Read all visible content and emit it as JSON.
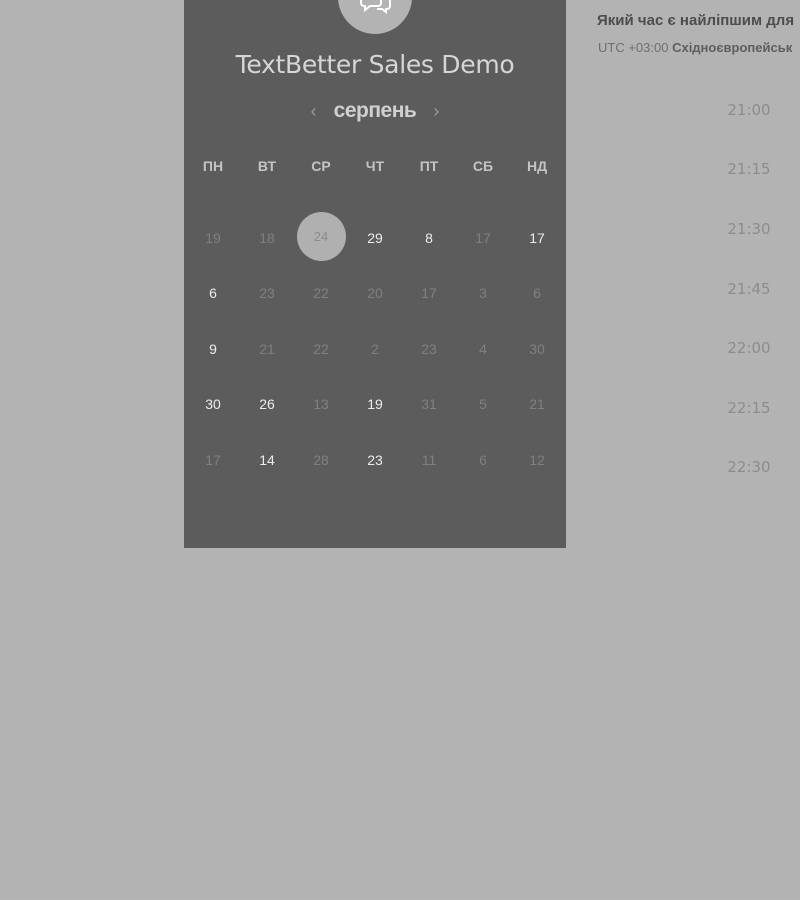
{
  "event": {
    "title": "TextBetter Sales Demo",
    "logo_icon": "chat-bubbles-icon"
  },
  "calendar": {
    "month": "серпень",
    "prev_icon": "chevron-left-icon",
    "next_icon": "chevron-right-icon",
    "weekdays": [
      "ПН",
      "ВТ",
      "СР",
      "ЧТ",
      "ПТ",
      "СБ",
      "НД"
    ],
    "weeks": [
      [
        {
          "d": "19",
          "a": false
        },
        {
          "d": "18",
          "a": false
        },
        {
          "d": "24",
          "a": false,
          "sel": true
        },
        {
          "d": "29",
          "a": true
        },
        {
          "d": "8",
          "a": true
        },
        {
          "d": "17",
          "a": false
        },
        {
          "d": "17",
          "a": true
        }
      ],
      [
        {
          "d": "6",
          "a": true
        },
        {
          "d": "23",
          "a": false
        },
        {
          "d": "22",
          "a": false
        },
        {
          "d": "20",
          "a": false
        },
        {
          "d": "17",
          "a": false
        },
        {
          "d": "3",
          "a": false
        },
        {
          "d": "6",
          "a": false
        }
      ],
      [
        {
          "d": "9",
          "a": true
        },
        {
          "d": "21",
          "a": false
        },
        {
          "d": "22",
          "a": false
        },
        {
          "d": "2",
          "a": false
        },
        {
          "d": "23",
          "a": false
        },
        {
          "d": "4",
          "a": false
        },
        {
          "d": "30",
          "a": false
        }
      ],
      [
        {
          "d": "30",
          "a": true
        },
        {
          "d": "26",
          "a": true
        },
        {
          "d": "13",
          "a": false
        },
        {
          "d": "19",
          "a": true
        },
        {
          "d": "31",
          "a": false
        },
        {
          "d": "5",
          "a": false
        },
        {
          "d": "21",
          "a": false
        }
      ],
      [
        {
          "d": "17",
          "a": false
        },
        {
          "d": "14",
          "a": true
        },
        {
          "d": "28",
          "a": false
        },
        {
          "d": "23",
          "a": true
        },
        {
          "d": "11",
          "a": false
        },
        {
          "d": "6",
          "a": false
        },
        {
          "d": "12",
          "a": false
        }
      ]
    ]
  },
  "times": {
    "heading": "Який час є найліпшим для",
    "tz_offset": "UTC +03:00",
    "tz_name": "Східноєвропейськ",
    "slots": [
      "21:00",
      "21:15",
      "21:30",
      "21:45",
      "22:00",
      "22:15",
      "22:30"
    ]
  }
}
